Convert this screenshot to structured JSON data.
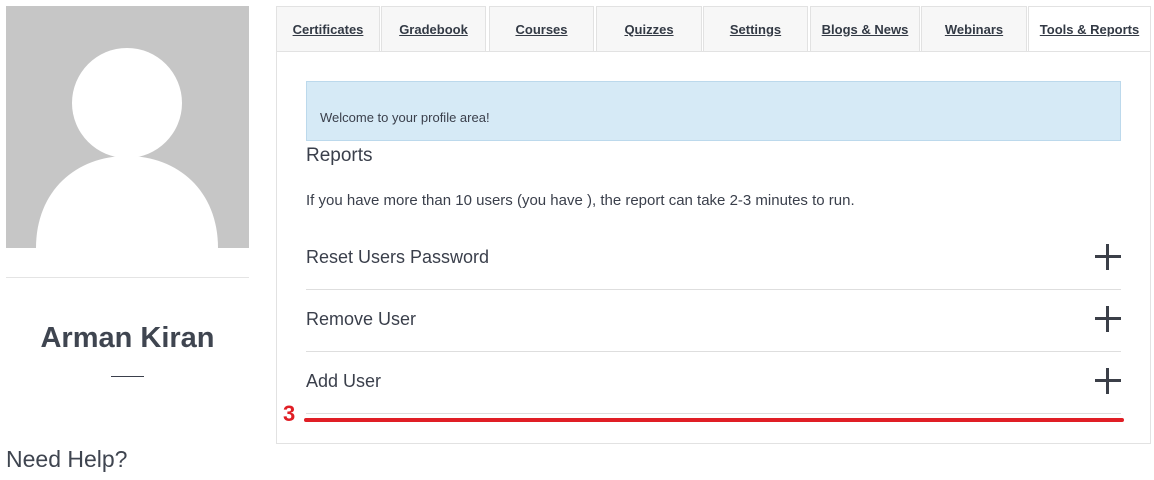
{
  "profile": {
    "name": "Arman Kiran",
    "help_heading": "Need Help?"
  },
  "tabs": [
    {
      "label": "Certificates"
    },
    {
      "label": "Gradebook"
    },
    {
      "label": "Courses"
    },
    {
      "label": "Quizzes"
    },
    {
      "label": "Settings"
    },
    {
      "label": "Blogs & News"
    },
    {
      "label": "Webinars"
    },
    {
      "label": "Tools & Reports",
      "active": true
    }
  ],
  "main": {
    "welcome_message": "Welcome to your profile area!",
    "reports_title": "Reports",
    "reports_note": "If you have more than 10 users (you have ), the report can take 2-3 minutes to run.",
    "accordion": [
      {
        "label": "Reset Users Password",
        "icon": "plus-icon"
      },
      {
        "label": "Remove User",
        "icon": "plus-icon"
      },
      {
        "label": "Add User",
        "icon": "plus-icon"
      }
    ]
  },
  "annotation": {
    "number": "3",
    "color": "#e01e25"
  },
  "colors": {
    "welcome_bg": "#d6eaf6",
    "avatar_bg": "#c6c6c6",
    "text": "#3a3f4b"
  }
}
